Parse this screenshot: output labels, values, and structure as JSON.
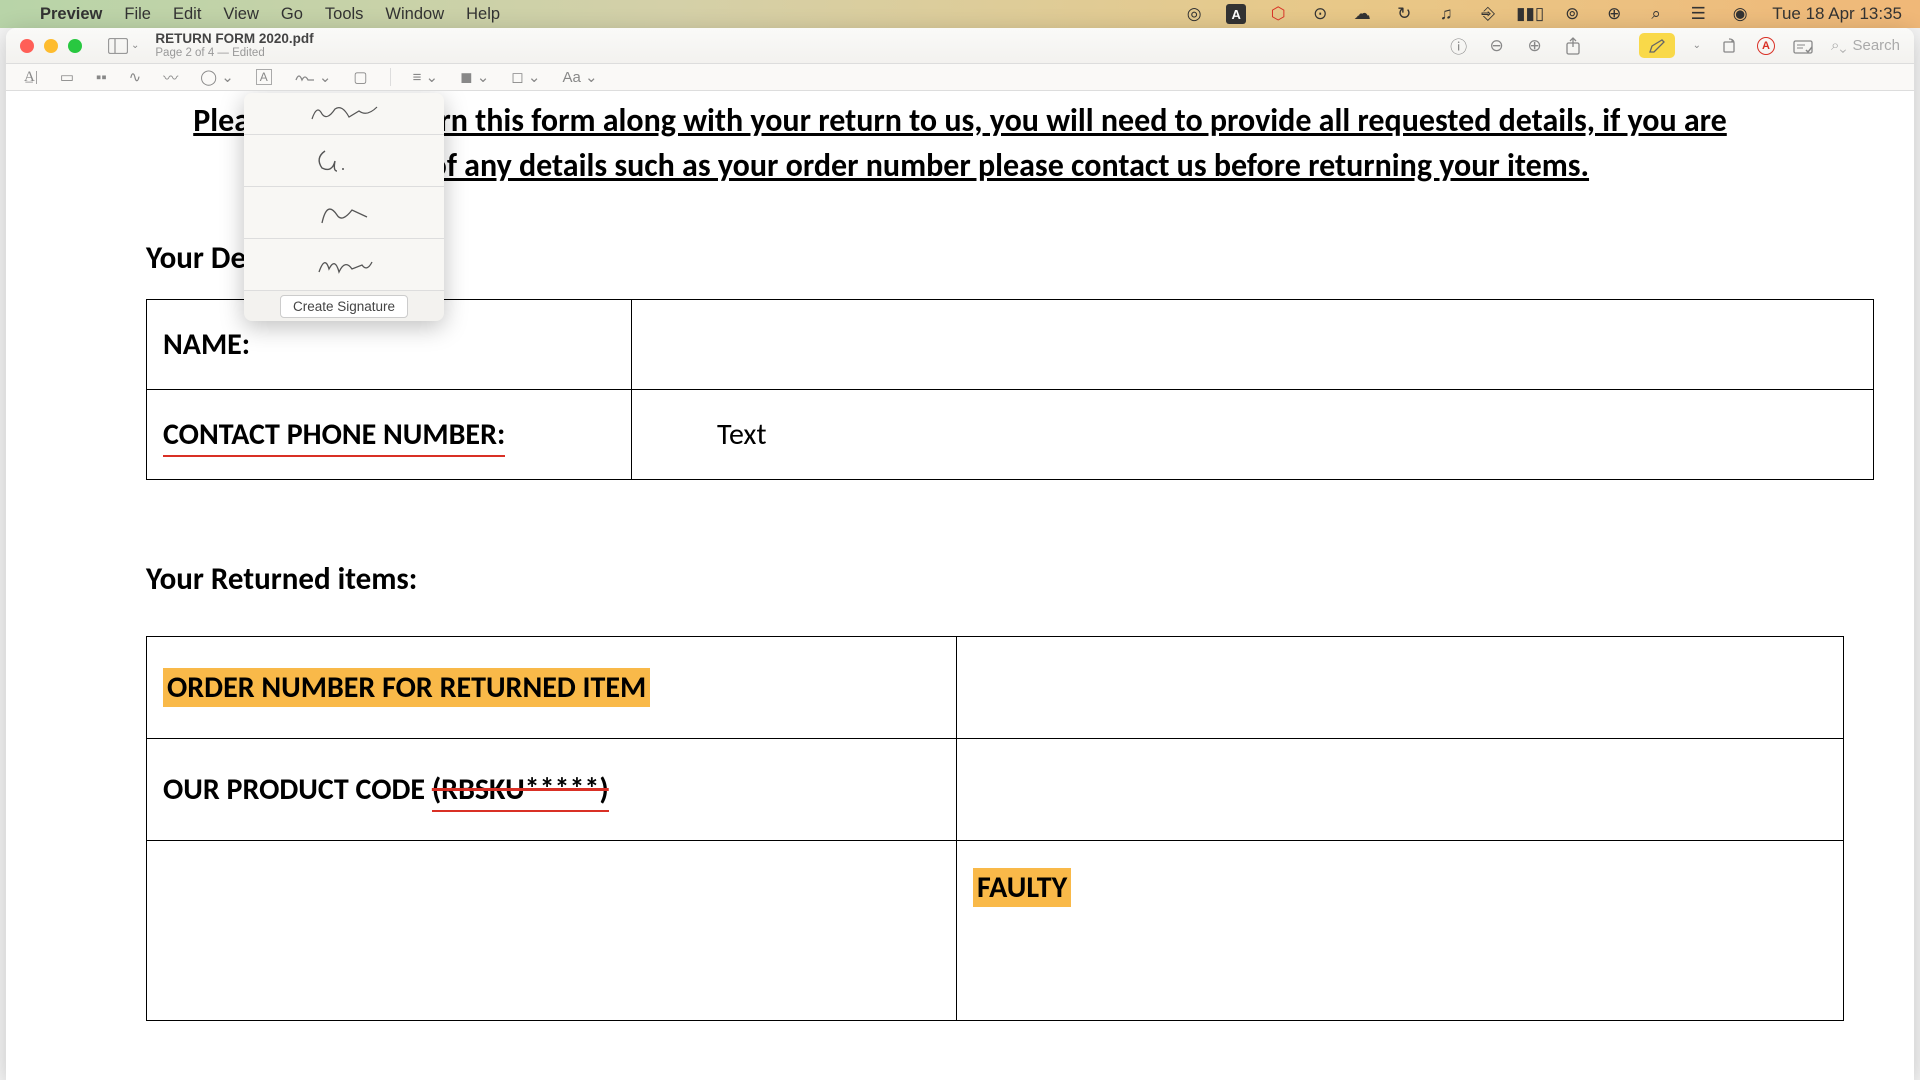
{
  "menubar": {
    "app_name": "Preview",
    "items": [
      "File",
      "Edit",
      "View",
      "Go",
      "Tools",
      "Window",
      "Help"
    ],
    "clock": "Tue 18 Apr 13:35"
  },
  "window": {
    "title": "RETURN FORM 2020.pdf",
    "subtitle": "Page 2 of 4 — Edited",
    "search_placeholder": "Search"
  },
  "signature_popover": {
    "create_label": "Create Signature"
  },
  "document": {
    "header": "Please fill and return this form along with your return to us, you will need to provide all requested details, if you are unsure of any details such as your order number please contact us before returning your items.",
    "section1_heading": "Your Details:",
    "name_label": "NAME:",
    "contact_label": "CONTACT PHONE NUMBER:",
    "contact_value": "Text",
    "section2_heading": "Your Returned items:",
    "order_label": "ORDER NUMBER FOR RETURNED ITEM",
    "product_code_prefix": "OUR PRODUCT CODE ",
    "product_code_strike": "(RBSKU*****)",
    "faulty_label": "FAULTY"
  }
}
